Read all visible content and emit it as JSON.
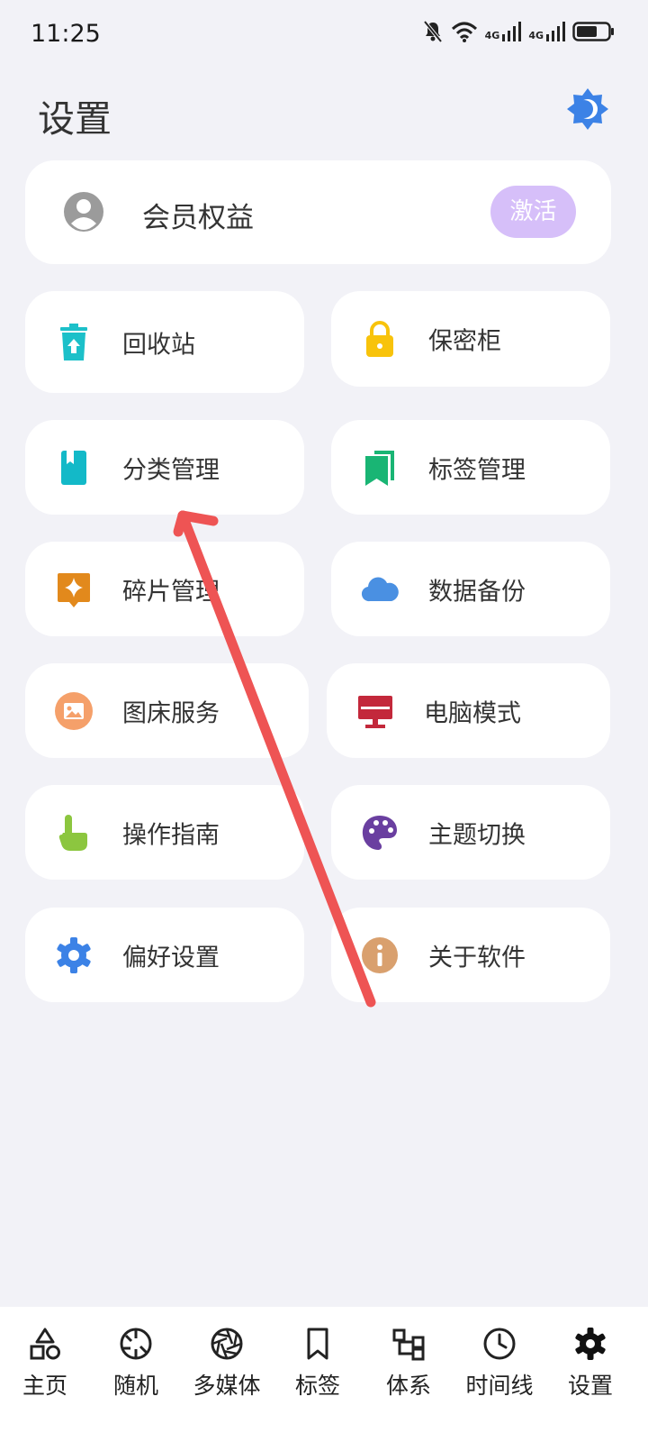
{
  "status_bar": {
    "time": "11:25",
    "network_1": "4G",
    "network_2": "4G"
  },
  "header": {
    "title": "设置"
  },
  "member": {
    "label": "会员权益",
    "action": "激活"
  },
  "tiles": [
    {
      "label": "回收站",
      "icon": "recycle-bin-icon",
      "color": "#1cc0c9"
    },
    {
      "label": "保密柜",
      "icon": "lock-icon",
      "color": "#f8c30b"
    },
    {
      "label": "分类管理",
      "icon": "book-icon",
      "color": "#13b9c8"
    },
    {
      "label": "标签管理",
      "icon": "bookmarks-icon",
      "color": "#19b574"
    },
    {
      "label": "碎片管理",
      "icon": "sparkle-icon",
      "color": "#e2891c"
    },
    {
      "label": "数据备份",
      "icon": "cloud-icon",
      "color": "#4a90e2"
    },
    {
      "label": "图床服务",
      "icon": "image-icon",
      "color": "#f5a06a"
    },
    {
      "label": "电脑模式",
      "icon": "monitor-icon",
      "color": "#c3283b"
    },
    {
      "label": "操作指南",
      "icon": "hand-pointer-icon",
      "color": "#8cc63f"
    },
    {
      "label": "主题切换",
      "icon": "palette-icon",
      "color": "#6a3fa0"
    },
    {
      "label": "偏好设置",
      "icon": "gear-icon",
      "color": "#3c82e6"
    },
    {
      "label": "关于软件",
      "icon": "info-icon",
      "color": "#d9a06e"
    }
  ],
  "nav": [
    {
      "label": "主页",
      "icon": "home-shapes-icon"
    },
    {
      "label": "随机",
      "icon": "random-icon"
    },
    {
      "label": "多媒体",
      "icon": "aperture-icon"
    },
    {
      "label": "标签",
      "icon": "bookmark-icon"
    },
    {
      "label": "体系",
      "icon": "hierarchy-icon"
    },
    {
      "label": "时间线",
      "icon": "clock-icon"
    },
    {
      "label": "设置",
      "icon": "gear-icon"
    }
  ],
  "colors": {
    "accent": "#3c82e6",
    "activate_bg": "#d6bff9",
    "arrow": "#ee5454",
    "background": "#f2f2f7"
  }
}
